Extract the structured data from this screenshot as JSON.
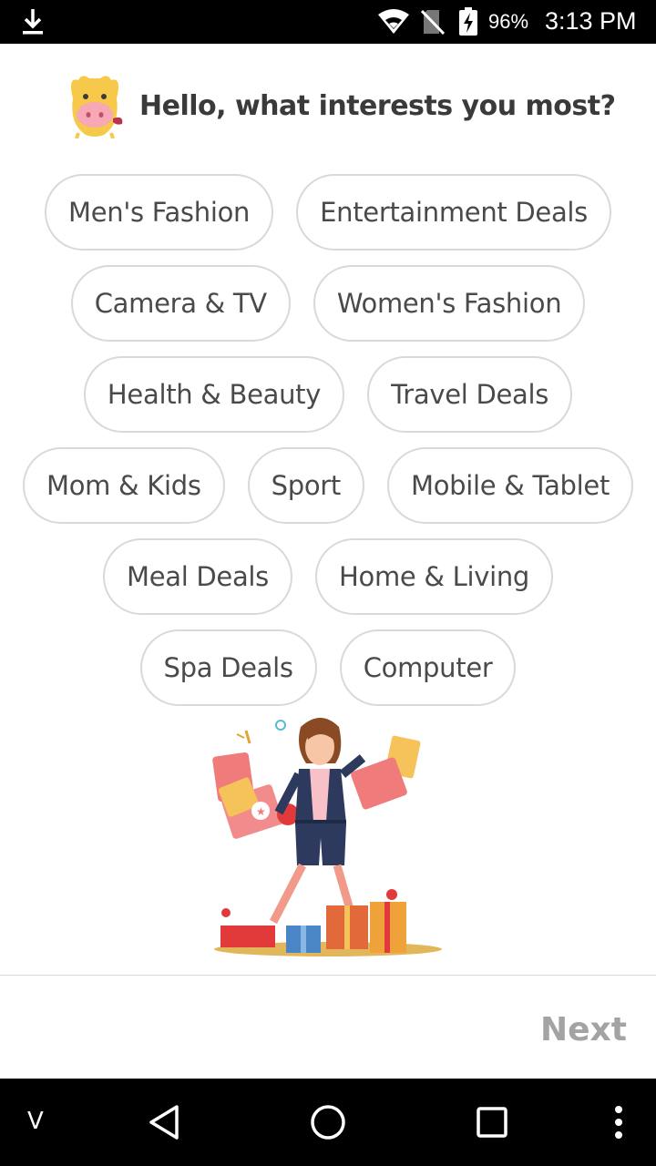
{
  "status_bar": {
    "battery_pct": "96%",
    "time": "3:13 PM",
    "icons": [
      "download-icon",
      "wifi-icon",
      "no-sim-icon",
      "battery-charging-icon"
    ]
  },
  "header": {
    "title": "Hello, what interests you most?"
  },
  "chip_rows": [
    [
      "Men's Fashion",
      "Entertainment Deals"
    ],
    [
      "Camera & TV",
      "Women's Fashion"
    ],
    [
      "Health & Beauty",
      "Travel Deals"
    ],
    [
      "Mom & Kids",
      "Sport",
      "Mobile & Tablet"
    ],
    [
      "Meal Deals",
      "Home & Living"
    ],
    [
      "Spa Deals",
      "Computer"
    ]
  ],
  "footer": {
    "next_label": "Next"
  },
  "nav_bar": {
    "v_label": "V",
    "icons": [
      "back-icon",
      "home-icon",
      "recents-icon",
      "more-icon"
    ]
  },
  "colors": {
    "chip_border": "#d9d9d9",
    "chip_text": "#4a4a4a",
    "next_disabled": "#a3a3a3"
  }
}
